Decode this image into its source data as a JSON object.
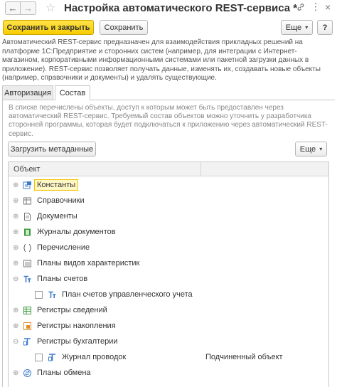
{
  "window": {
    "title": "Настройка автоматического REST-сервиса *",
    "back_glyph": "←",
    "forward_glyph": "→",
    "star_glyph": "☆",
    "link_glyph": "🔗",
    "menu_glyph": "⋮",
    "close_glyph": "×"
  },
  "toolbar": {
    "save_close_label": "Сохранить и закрыть",
    "save_label": "Сохранить",
    "more_label": "Еще",
    "more_arrow": "▾",
    "help_label": "?"
  },
  "description": "Автоматический REST-сервис предназначен для взаимодействия прикладных решений на платформе 1С:Предприятие и сторонних систем (например, для интеграции с Интернет-магазином, корпоративными информационными системами или пакетной загрузки данных в приложение). REST-сервис позволяет получать данные, изменять их, создавать новые объекты (например, справочники и документы) и удалять существующие.",
  "tabs": [
    {
      "label": "Авторизация",
      "active": false
    },
    {
      "label": "Состав",
      "active": true
    }
  ],
  "composition": {
    "hint": "В списке перечислены объекты, доступ к которым может быть предоставлен через автоматический REST-сервис. Требуемый состав объектов можно уточнить у разработчика сторонней программы, которая будет подключаться к приложению через автоматический REST-сервис.",
    "load_metadata_label": "Загрузить метаданные",
    "more_label": "Еще",
    "more_arrow": "▾",
    "table": {
      "columns": [
        "Объект",
        ""
      ],
      "rows": [
        {
          "expander": "⊕",
          "label": "Константы",
          "col2": "",
          "selected": true,
          "child": false,
          "icon": "constants-icon"
        },
        {
          "expander": "⊕",
          "label": "Справочники",
          "col2": "",
          "selected": false,
          "child": false,
          "icon": "catalogs-icon"
        },
        {
          "expander": "⊕",
          "label": "Документы",
          "col2": "",
          "selected": false,
          "child": false,
          "icon": "documents-icon"
        },
        {
          "expander": "⊕",
          "label": "Журналы документов",
          "col2": "",
          "selected": false,
          "child": false,
          "icon": "document-journals-icon"
        },
        {
          "expander": "⊕",
          "label": "Перечисление",
          "col2": "",
          "selected": false,
          "child": false,
          "icon": "enumerations-icon"
        },
        {
          "expander": "⊕",
          "label": "Планы видов характеристик",
          "col2": "",
          "selected": false,
          "child": false,
          "icon": "characteristic-types-icon"
        },
        {
          "expander": "⊖",
          "label": "Планы счетов",
          "col2": "",
          "selected": false,
          "child": false,
          "icon": "chart-of-accounts-icon"
        },
        {
          "expander": "",
          "label": "План счетов управленческого учета",
          "col2": "",
          "selected": false,
          "child": true,
          "icon": "chart-of-accounts-icon"
        },
        {
          "expander": "⊕",
          "label": "Регистры сведений",
          "col2": "",
          "selected": false,
          "child": false,
          "icon": "information-registers-icon"
        },
        {
          "expander": "⊕",
          "label": "Регистры накопления",
          "col2": "",
          "selected": false,
          "child": false,
          "icon": "accumulation-registers-icon"
        },
        {
          "expander": "⊖",
          "label": "Регистры бухгалтерии",
          "col2": "",
          "selected": false,
          "child": false,
          "icon": "accounting-registers-icon"
        },
        {
          "expander": "",
          "label": "Журнал проводок",
          "col2": "Подчиненный объект",
          "selected": false,
          "child": true,
          "icon": "accounting-registers-icon"
        },
        {
          "expander": "⊕",
          "label": "Планы обмена",
          "col2": "",
          "selected": false,
          "child": false,
          "icon": "exchange-plans-icon"
        }
      ]
    }
  },
  "colors": {
    "primary_button": "#f7cc00",
    "selection_border": "#f0c200",
    "icon_green": "#3a9a3a",
    "icon_blue": "#3d7cc9",
    "icon_orange": "#e0902a"
  }
}
